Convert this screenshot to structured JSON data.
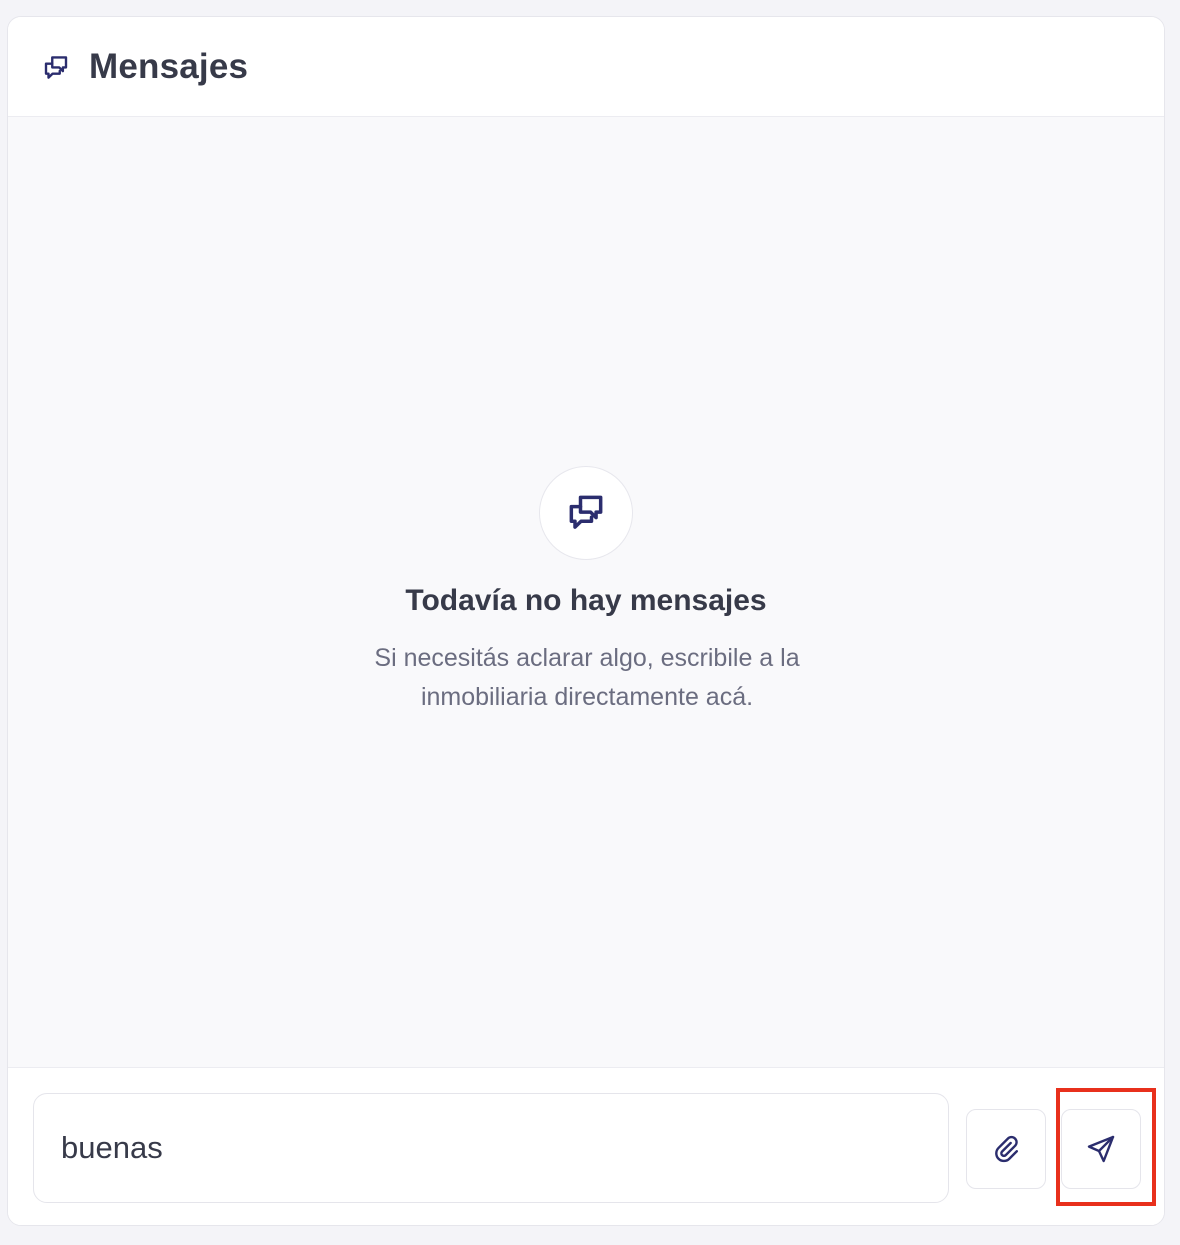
{
  "header": {
    "title": "Mensajes",
    "icon": "chat-bubbles-icon"
  },
  "empty_state": {
    "icon": "chat-bubbles-icon",
    "title": "Todavía no hay mensajes",
    "subtitle": "Si necesitás aclarar algo, escribile a la inmobiliaria directamente acá."
  },
  "composer": {
    "input_value": "buenas",
    "attach_icon": "paperclip-icon",
    "send_icon": "send-icon"
  },
  "colors": {
    "accent": "#2b2d6e",
    "text_primary": "#373a49",
    "text_secondary": "#6b6d80",
    "highlight": "#e8301c"
  }
}
